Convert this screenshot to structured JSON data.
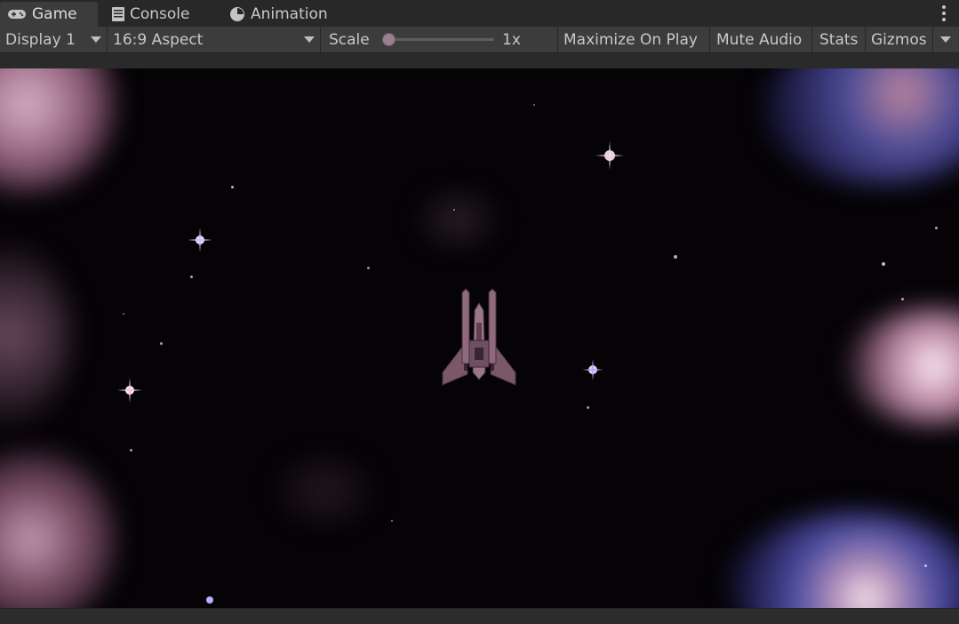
{
  "tabs": [
    {
      "label": "Game",
      "icon": "gamepad-icon",
      "active": true
    },
    {
      "label": "Console",
      "icon": "console-icon",
      "active": false
    },
    {
      "label": "Animation",
      "icon": "clock-icon",
      "active": false
    }
  ],
  "toolbar": {
    "display": "Display 1",
    "aspect": "16:9 Aspect",
    "scale_label": "Scale",
    "scale_value": "1x",
    "maximize": "Maximize On Play",
    "mute": "Mute Audio",
    "stats": "Stats",
    "gizmos": "Gizmos"
  },
  "colors": {
    "panel": "#282828",
    "toolbar": "#3c3c3c",
    "space": "#050306",
    "nebula_pink": "#c08aa6",
    "nebula_blue": "#3a3a8a"
  }
}
